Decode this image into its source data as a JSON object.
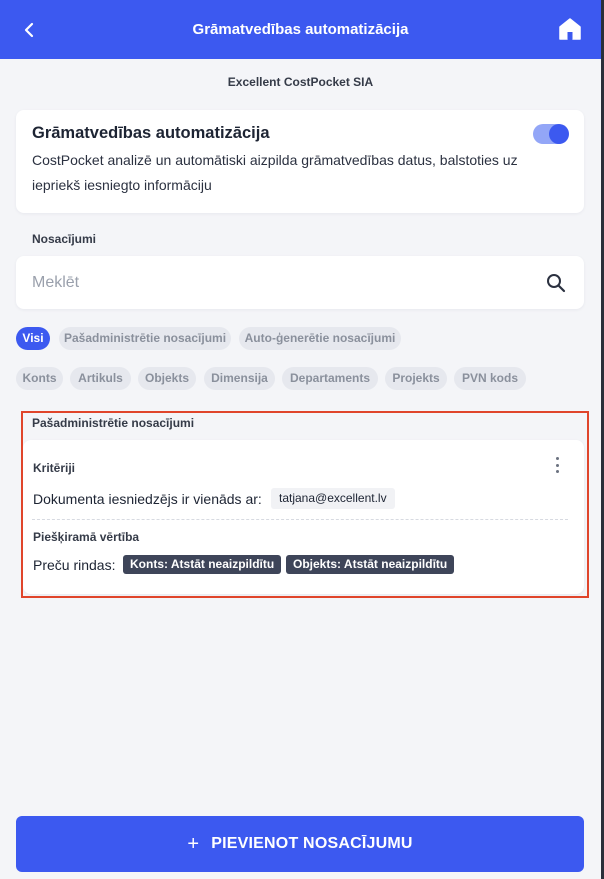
{
  "header": {
    "title": "Grāmatvedības automatizācija",
    "back_icon": "chevron-left-icon",
    "home_icon": "home-icon",
    "color": "#3c59f0"
  },
  "company": "Excellent CostPocket SIA",
  "automation": {
    "title": "Grāmatvedības automatizācija",
    "description": "CostPocket analizē un automātiski aizpilda grāmatvedības datus, balstoties uz iepriekš iesniegto informāciju",
    "toggle_on": true
  },
  "conditions": {
    "label": "Nosacījumi",
    "search_placeholder": "Meklēt",
    "search_value": ""
  },
  "filter_chips": [
    {
      "label": "Visi",
      "active": true
    },
    {
      "label": "Pašadministrētie nosacījumi",
      "active": false
    },
    {
      "label": "Auto-ģenerētie nosacījumi",
      "active": false
    }
  ],
  "category_chips": [
    "Konts",
    "Artikuls",
    "Objekts",
    "Dimensija",
    "Departaments",
    "Projekts",
    "PVN kods"
  ],
  "self_admin": {
    "title": "Pašadministrētie nosacījumi",
    "rule": {
      "criteria_label": "Kritēriji",
      "criteria_text": "Dokumenta iesniedzējs ir vienāds ar:",
      "criteria_value": "tatjana@excellent.lv",
      "assign_label": "Piešķiramā vērtība",
      "assign_text": "Preču rindas:",
      "assign_tags": [
        "Konts: Atstāt neaizpildītu",
        "Objekts: Atstāt neaizpildītu"
      ]
    }
  },
  "add_button": {
    "icon": "plus",
    "label": "PIEVIENOT NOSACĪJUMU"
  }
}
